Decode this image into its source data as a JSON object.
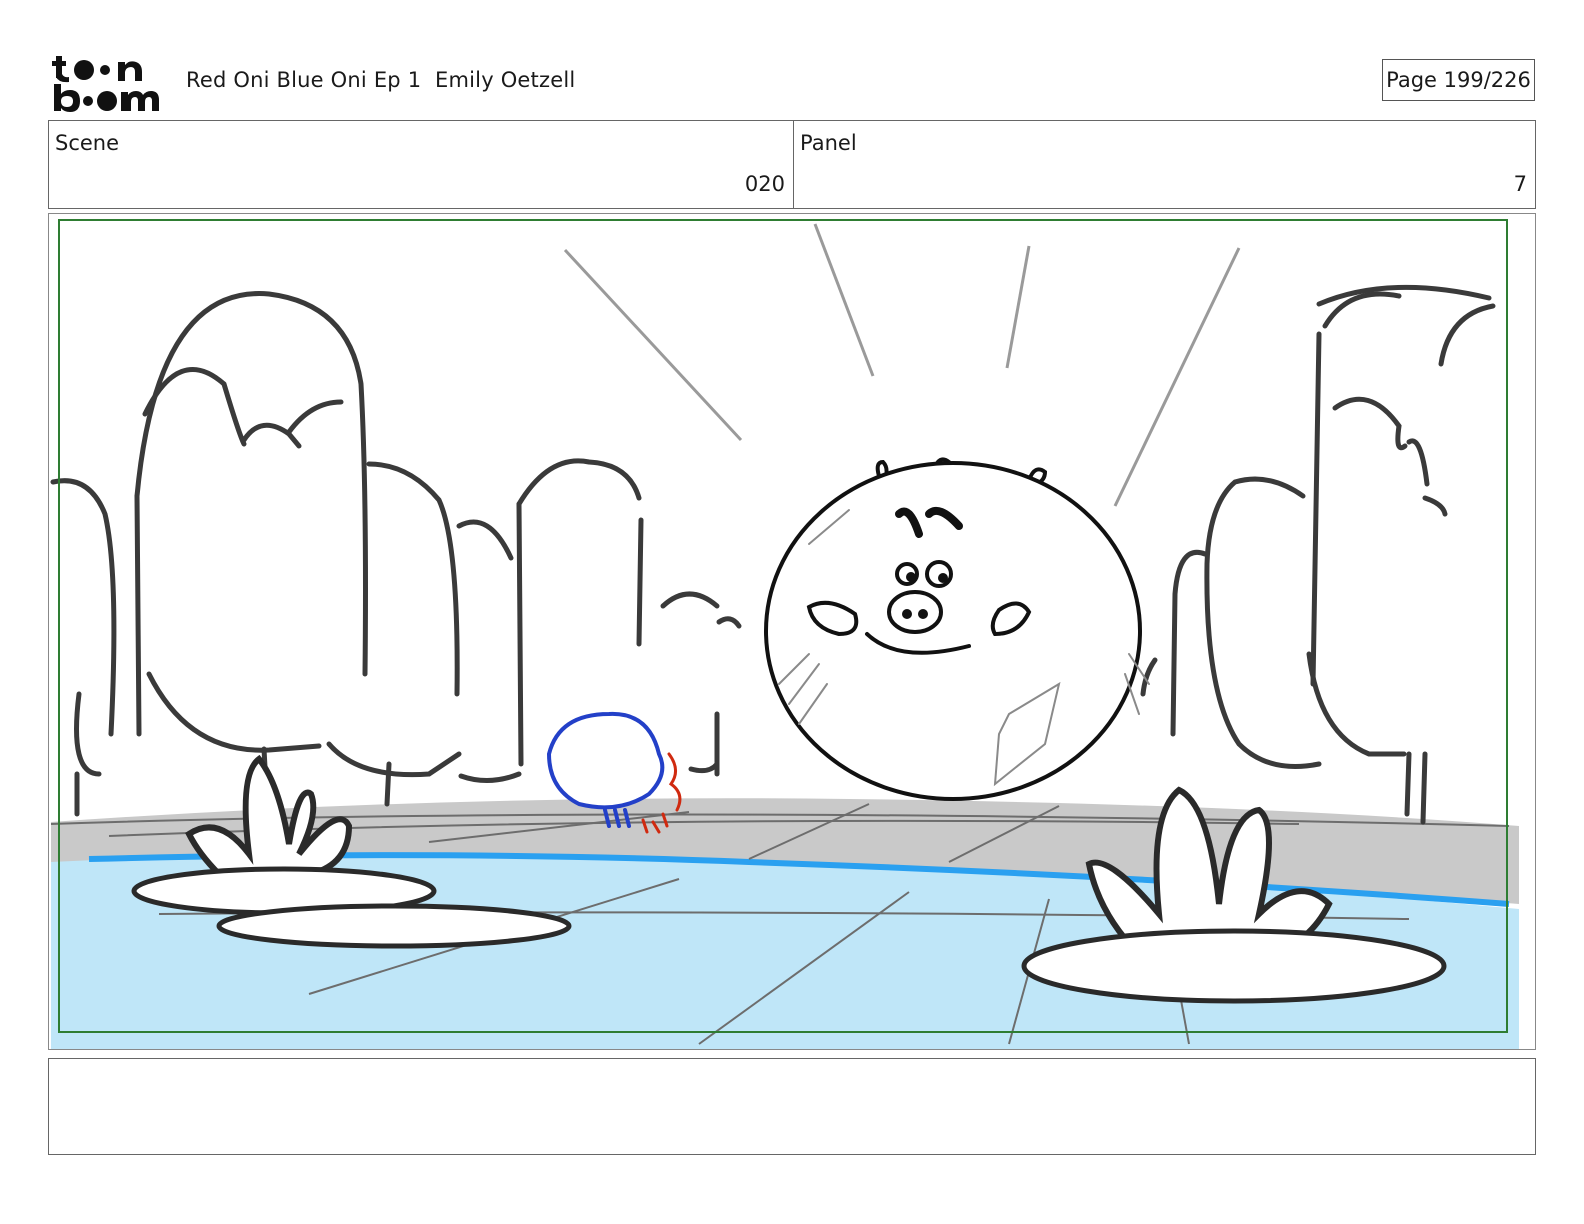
{
  "header": {
    "logo_text": "toon boom",
    "project_title": "Red Oni Blue Oni Ep 1  Emily Oetzell",
    "page_label": "Page 199/226"
  },
  "info": {
    "scene_label": "Scene",
    "scene_value": "020",
    "panel_label": "Panel",
    "panel_value": "7"
  },
  "panel_image": {
    "frame_color": "#2e7d32",
    "water_color": "#bfe6f8",
    "water_edge_color": "#2aa0f0",
    "ground_color": "#c7c7c7",
    "line_color": "#3a3a3a",
    "blue_oni_color": "#2340c8",
    "red_oni_color": "#d02a10"
  },
  "notes": {
    "text": ""
  }
}
